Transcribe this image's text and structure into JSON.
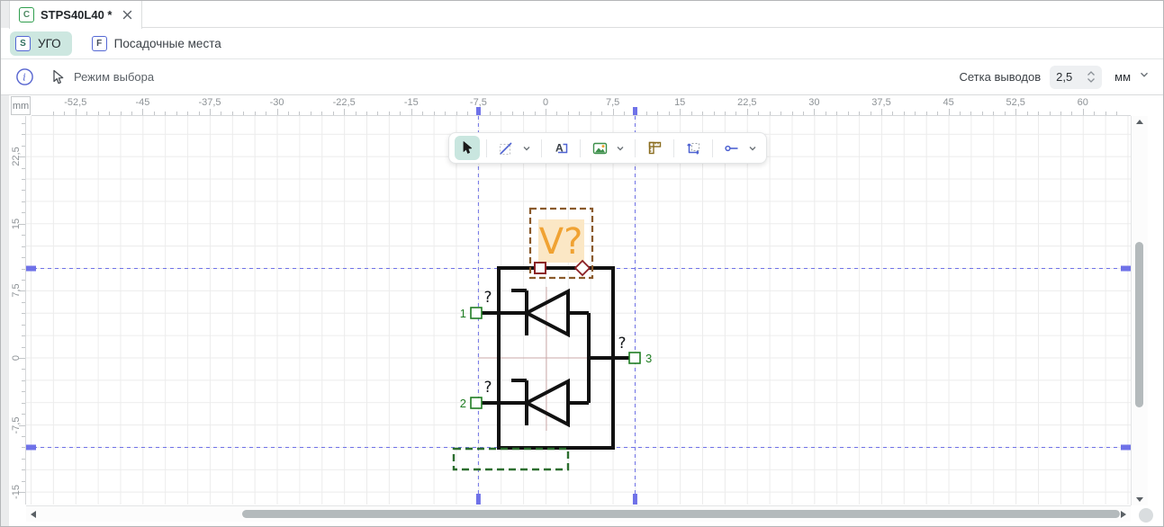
{
  "tab_bar": {
    "tab_icon_letter": "C",
    "tab_title": "STPS40L40 *"
  },
  "mode_bar": {
    "ugo_icon_letter": "S",
    "ugo_label": "УГО",
    "footprints_icon_letter": "F",
    "footprints_label": "Посадочные места"
  },
  "toolbar": {
    "mode_label": "Режим выбора",
    "pin_grid_label": "Сетка выводов",
    "pin_grid_value": "2,5",
    "pin_grid_unit": "мм"
  },
  "rulers": {
    "unit_label": "mm",
    "h_labels": [
      "-52,5",
      "-45",
      "-37,5",
      "-30",
      "-22,5",
      "-15",
      "-7,5",
      "0",
      "7,5",
      "15",
      "22,5",
      "30",
      "37,5",
      "45",
      "52,5",
      "60"
    ],
    "v_labels": [
      "22,5",
      "15",
      "7,5",
      "0",
      "-7,5",
      "-15"
    ]
  },
  "guides": {
    "vertical_mm": [
      -7.5,
      10
    ],
    "horizontal_mm": [
      10,
      -10
    ]
  },
  "floating_toolbar": {
    "tools": [
      "select",
      "line",
      "text",
      "image",
      "measure",
      "transform",
      "pin"
    ]
  },
  "symbol": {
    "designator": "V?",
    "pins": [
      {
        "number": "1",
        "name": "?"
      },
      {
        "number": "2",
        "name": "?"
      },
      {
        "number": "3",
        "name": "?"
      }
    ]
  },
  "colors": {
    "selection_teal": "#c9e6df",
    "guide_blue": "#6f72e8",
    "pin_green": "#1f7d22",
    "designator_orange": "#f0a232",
    "designator_bg": "#fbe7c5",
    "selection_frame_brown": "#8a5a2b",
    "handle_red": "#8b1f24",
    "body_dash_green": "#2c6e2f"
  }
}
